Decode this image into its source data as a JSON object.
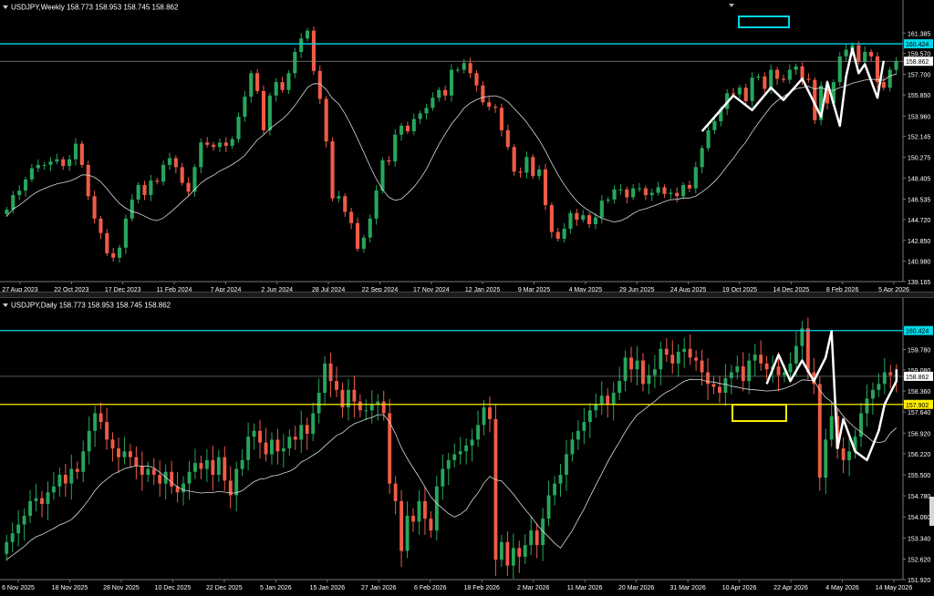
{
  "window": {
    "top_header": {
      "symbol": "USDJPY,Weekly",
      "ohlc": "158.773 158.953 158.745 158.862"
    },
    "bottom_header": {
      "symbol": "USDJPY,Daily",
      "ohlc": "158.773 158.953 158.745 158.862"
    }
  },
  "colors": {
    "background": "#000000",
    "bull": "#26a65b",
    "bear": "#ef5b47",
    "ma": "#d9d9d9",
    "cyan": "#00d8e8",
    "yellow": "#ffee00",
    "grid": "#555555",
    "text": "#ffffff"
  },
  "chart_data": [
    {
      "type": "candlestick",
      "timeframe": "Weekly",
      "ylim": [
        139.165,
        163.2
      ],
      "y_ticks": [
        "161.385",
        "159.570",
        "158.862",
        "157.700",
        "155.850",
        "153.960",
        "152.145",
        "150.275",
        "148.405",
        "146.535",
        "144.720",
        "142.850",
        "140.980",
        "139.165"
      ],
      "x_ticks": [
        "27 Aug 2023",
        "22 Oct 2023",
        "17 Dec 2023",
        "11 Feb 2024",
        "7 Apr 2024",
        "2 Jun 2024",
        "28 Jul 2024",
        "22 Sep 2024",
        "17 Nov 2024",
        "12 Jan 2025",
        "9 Mar 2025",
        "4 May 2025",
        "29 Jun 2025",
        "24 Aug 2025",
        "19 Oct 2025",
        "14 Dec 2025",
        "8 Feb 2026",
        "5 Apr 2026"
      ],
      "level_lines": [
        {
          "label": "160.424",
          "value": 160.424,
          "color": "#00d8e8"
        },
        {
          "label": "158.862",
          "value": 158.862,
          "color": "#888888"
        }
      ],
      "series": [
        {
          "values_close": [
            145.6,
            146.9,
            147.3,
            148.3,
            149.3,
            149.6,
            149.6,
            149.9,
            150.1,
            149.5,
            150.1,
            151.5,
            149.6,
            146.8,
            144.8,
            143.5,
            141.7,
            141.3,
            142.2,
            144.8,
            146.5,
            147.8,
            146.9,
            148.2,
            148.1,
            149.6,
            150.2,
            149.4,
            148.0,
            147.2,
            149.4,
            151.6,
            151.4,
            151.2,
            151.6,
            151.3,
            151.9,
            153.9,
            155.7,
            157.8,
            156.2,
            152.7,
            155.8,
            157.0,
            156.3,
            157.8,
            159.7,
            160.9,
            161.6,
            158.0,
            155.5,
            151.7,
            146.6,
            146.8,
            145.4,
            144.4,
            142.1,
            143.1,
            144.8,
            147.3,
            150.0,
            149.9,
            152.3,
            153.1,
            152.6,
            153.7,
            154.2,
            154.7,
            155.6,
            156.3,
            155.8,
            158.1,
            158.1,
            158.7,
            157.8,
            156.7,
            155.2,
            154.8,
            154.7,
            152.7,
            151.2,
            149.0,
            148.9,
            150.3,
            148.6,
            149.2,
            146.0,
            143.6,
            143.0,
            143.9,
            145.3,
            144.7,
            145.1,
            144.3,
            144.9,
            146.4,
            146.5,
            147.4,
            147.4,
            146.7,
            147.5,
            147.5,
            146.9,
            147.1,
            147.6,
            147.0,
            147.1,
            146.8,
            147.8,
            147.5,
            149.4,
            151.1,
            152.7,
            153.5,
            154.6,
            156.0,
            155.9,
            156.5,
            155.3,
            157.4,
            157.5,
            156.4,
            158.1,
            157.3,
            157.2,
            158.1,
            158.4,
            157.3,
            157.2,
            153.6,
            156.7,
            155.1,
            157.0,
            159.3,
            159.9,
            160.3,
            158.8,
            159.7,
            159.3,
            157.0,
            156.5,
            158.1,
            158.86
          ]
        },
        {
          "name": "",
          "type": "moving_average"
        }
      ],
      "annotations": [
        "cyan rectangle target box near 161.4",
        "white zig-zag trend drawing"
      ]
    },
    {
      "type": "candlestick",
      "timeframe": "Daily",
      "ylim": [
        151.92,
        161.1
      ],
      "y_ticks": [
        "159.780",
        "159.080",
        "158.862",
        "158.360",
        "157.902",
        "157.640",
        "156.920",
        "156.220",
        "155.500",
        "154.780",
        "154.060",
        "153.340",
        "152.620",
        "151.920"
      ],
      "x_ticks": [
        "6 Nov 2025",
        "18 Nov 2025",
        "28 Nov 2025",
        "10 Dec 2025",
        "22 Dec 2025",
        "5 Jan 2026",
        "15 Jan 2026",
        "27 Jan 2026",
        "6 Feb 2026",
        "18 Feb 2026",
        "2 Mar 2026",
        "11 Mar 2026",
        "20 Mar 2026",
        "31 Mar 2026",
        "10 Apr 2026",
        "22 Apr 2026",
        "4 May 2026",
        "14 May 2026"
      ],
      "level_lines": [
        {
          "label": "160.424",
          "value": 160.424,
          "color": "#00d8e8"
        },
        {
          "label": "158.862",
          "value": 158.862,
          "color": "#888888"
        },
        {
          "label": "157.902",
          "value": 157.902,
          "color": "#ffee00"
        }
      ],
      "series": [
        {
          "values_close": [
            153.2,
            153.5,
            153.8,
            154.1,
            154.6,
            154.7,
            154.5,
            154.9,
            155.1,
            155.5,
            155.2,
            155.7,
            155.6,
            156.3,
            157.0,
            157.6,
            157.3,
            156.7,
            156.4,
            156.1,
            156.3,
            156.1,
            155.8,
            155.5,
            155.7,
            155.5,
            155.2,
            155.6,
            155.1,
            154.9,
            155.2,
            155.6,
            155.9,
            155.7,
            156.0,
            155.5,
            156.1,
            155.3,
            154.8,
            155.7,
            156.0,
            156.8,
            157.0,
            156.6,
            156.2,
            156.7,
            156.3,
            156.4,
            156.8,
            156.7,
            157.2,
            156.9,
            157.6,
            158.3,
            159.3,
            158.7,
            158.4,
            157.8,
            158.4,
            158.0,
            157.7,
            157.7,
            157.9,
            158.0,
            157.6,
            155.2,
            154.6,
            152.9,
            154.1,
            153.9,
            154.6,
            154.0,
            153.6,
            155.1,
            155.7,
            156.0,
            156.2,
            156.3,
            156.5,
            156.7,
            157.2,
            157.8,
            157.4,
            152.6,
            153.2,
            152.4,
            153.0,
            152.7,
            153.1,
            153.6,
            153.1,
            154.0,
            154.8,
            155.2,
            155.5,
            156.2,
            156.7,
            157.0,
            157.3,
            157.7,
            157.9,
            158.2,
            157.9,
            158.3,
            158.7,
            159.5,
            159.1,
            159.4,
            158.6,
            158.9,
            159.1,
            159.8,
            159.6,
            159.3,
            159.7,
            159.8,
            159.5,
            159.4,
            159.0,
            158.6,
            158.5,
            158.3,
            158.8,
            159.0,
            159.2,
            158.7,
            159.4,
            159.6,
            159.3,
            159.1,
            159.2,
            158.9,
            159.0,
            159.3,
            159.9,
            160.5,
            159.0,
            158.6,
            155.4,
            156.7,
            157.5,
            156.4,
            156.0,
            156.3,
            156.8,
            157.6,
            158.1,
            158.4,
            158.6,
            159.0,
            158.9,
            158.86
          ]
        },
        {
          "name": "",
          "type": "moving_average"
        }
      ],
      "annotations": [
        "yellow rectangle box below 157.902",
        "white zig-zag trend drawing"
      ]
    }
  ]
}
